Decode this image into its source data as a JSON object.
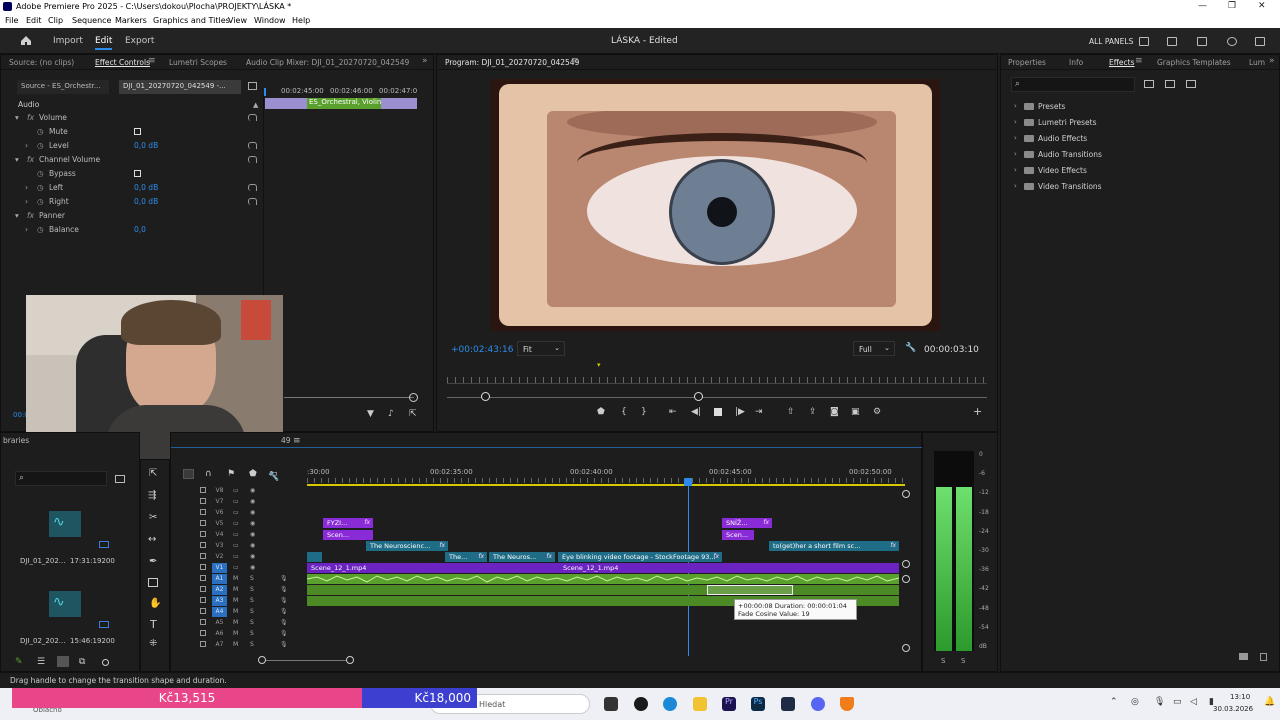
{
  "window": {
    "title": "Adobe Premiere Pro 2025 - C:\\Users\\dokou\\Plocha\\PROJEKTY\\LÁSKA *"
  },
  "menu": [
    "File",
    "Edit",
    "Clip",
    "Sequence",
    "Markers",
    "Graphics and Titles",
    "View",
    "Window",
    "Help"
  ],
  "header": {
    "nav": [
      "Import",
      "Edit",
      "Export"
    ],
    "active_nav": "Edit",
    "project_title": "LÁSKA",
    "status": "- Edited",
    "all_panels": "ALL PANELS"
  },
  "source_panel": {
    "tabs": [
      "Source: (no clips)",
      "Effect Controls",
      "Lumetri Scopes",
      "Audio Clip Mixer: DJI_01_20270720_042549"
    ],
    "active_tab": "Effect Controls",
    "clip_tabs": [
      "Source - ES_Orchestr...",
      "DJI_01_20270720_042549 -..."
    ],
    "mini_timecodes": [
      "00:02:45:00",
      "00:02:46:00",
      "00:02:47:0"
    ],
    "mini_clip": "ES_Orchestral, Violin,",
    "section": "Audio",
    "rows": [
      {
        "indent": 0,
        "label": "Volume",
        "value": "",
        "kind": "fx"
      },
      {
        "indent": 1,
        "label": "Mute",
        "value": "",
        "kind": "check"
      },
      {
        "indent": 1,
        "label": "Level",
        "value": "0,0 dB",
        "kind": "value"
      },
      {
        "indent": 0,
        "label": "Channel Volume",
        "value": "",
        "kind": "fx"
      },
      {
        "indent": 1,
        "label": "Bypass",
        "value": "",
        "kind": "check"
      },
      {
        "indent": 1,
        "label": "Left",
        "value": "0,0 dB",
        "kind": "value"
      },
      {
        "indent": 1,
        "label": "Right",
        "value": "0,0 dB",
        "kind": "value"
      },
      {
        "indent": 0,
        "label": "Panner",
        "value": "",
        "kind": "fx"
      },
      {
        "indent": 1,
        "label": "Balance",
        "value": "0,0",
        "kind": "value"
      }
    ],
    "timecode_cut": "00:0"
  },
  "program": {
    "title": "Program: DJI_01_20270720_042549",
    "left_timecode": "+00:02:43:16",
    "fit": "Fit",
    "quality": "Full",
    "right_timecode": "00:00:03:10"
  },
  "right_panel": {
    "tabs": [
      "Properties",
      "Info",
      "Effects",
      "Graphics Templates",
      "Lum"
    ],
    "active_tab": "Effects",
    "items": [
      "Presets",
      "Lumetri Presets",
      "Audio Effects",
      "Audio Transitions",
      "Video Effects",
      "Video Transitions"
    ]
  },
  "project": {
    "tab_cut": "braries",
    "seq_cut": "49",
    "items": [
      {
        "name": "DJI_01_202...",
        "time": "17:31:19200"
      },
      {
        "name": "DJI_02_202...",
        "time": "15:46:19200"
      }
    ]
  },
  "timeline": {
    "ruler": [
      ":30:00",
      "00:02:35:00",
      "00:02:40:00",
      "00:02:45:00",
      "00:02:50:00"
    ],
    "video_tracks": [
      "V8",
      "V7",
      "V6",
      "V5",
      "V4",
      "V3",
      "V2",
      "V1"
    ],
    "audio_tracks": [
      "A1",
      "A2",
      "A3",
      "A4",
      "A5",
      "A6",
      "A7"
    ],
    "clips": {
      "v5a": "FYZI...",
      "v5b": "SNÍŽ...",
      "v4a": "Scen...",
      "v4b": "Scen...",
      "v3a": "The Neuroscienc...",
      "v3b": "to(get)her  a short film sc...",
      "v2a": "The...",
      "v2b": "The Neuros...",
      "v2c": "Eye blinking video footage - StockFootage 93...",
      "v1": "Scene_12_1.mp4",
      "v1b": "Scene_12_1.mp4"
    },
    "tooltip_line1": "+00:00:08  Duration: 00:00:01:04",
    "tooltip_line2": "Fade Cosine Value: 19"
  },
  "meter": {
    "labels": [
      "0",
      "-6",
      "-12",
      "-18",
      "-24",
      "-30",
      "-36",
      "-42",
      "-48",
      "-54",
      "dB"
    ],
    "solo": [
      "S",
      "S"
    ],
    "level": 0.82
  },
  "status_bar": "Drag handle to change the transition shape and duration.",
  "ads": {
    "left_price": "Kč13,515",
    "right_price": "Kč18,000"
  },
  "taskbar": {
    "weather_cut": "Oblačno",
    "search": "Hledat",
    "time": "13:10",
    "date": "30.03.2026"
  },
  "colors": {
    "accent": "#2d8ceb",
    "clip_purple": "#8a2bd8",
    "clip_teal": "#1f6c86",
    "audio_green": "#5aa02c",
    "ad_pink": "#e9468a",
    "ad_blue": "#3d3fd1"
  }
}
